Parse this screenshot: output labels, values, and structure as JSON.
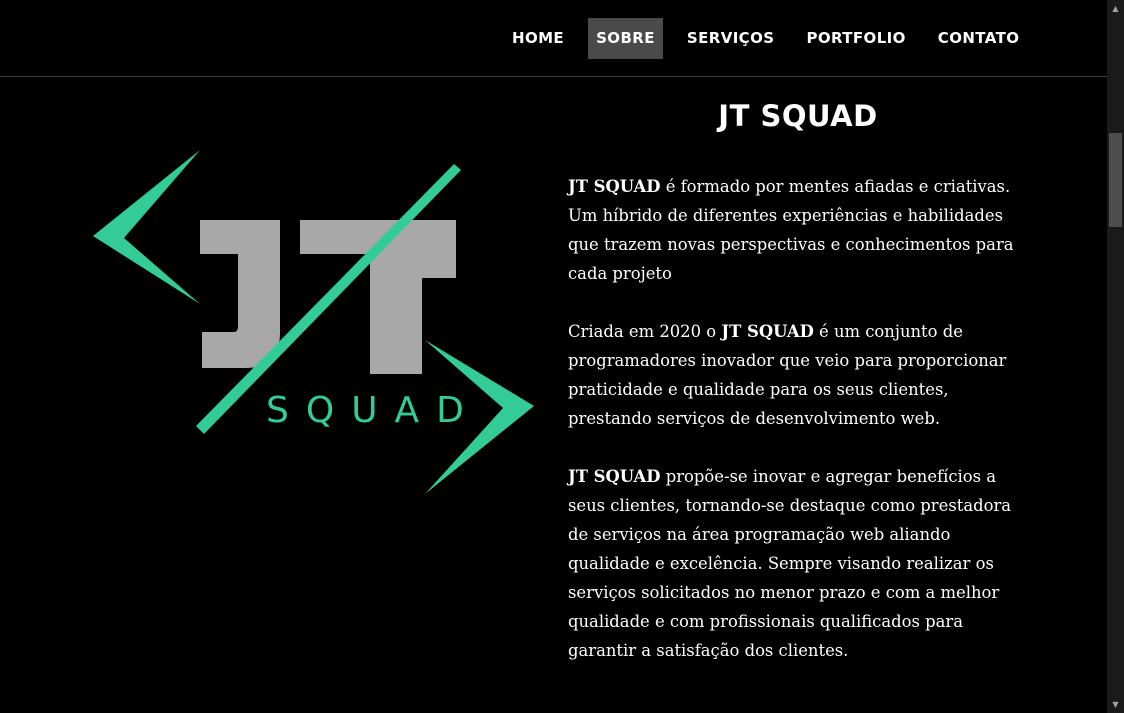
{
  "nav": {
    "items": [
      {
        "label": "HOME",
        "active": false
      },
      {
        "label": "SOBRE",
        "active": true
      },
      {
        "label": "SERVIÇOS",
        "active": false
      },
      {
        "label": "PORTFOLIO",
        "active": false
      },
      {
        "label": "CONTATO",
        "active": false
      }
    ]
  },
  "logo": {
    "letters": "JT",
    "word": "SQUAD",
    "colors": {
      "accent": "#33cc99",
      "letters": "#a8a8a8"
    }
  },
  "about": {
    "title": "JT SQUAD",
    "p1": {
      "strong": "JT SQUAD",
      "text": " é formado por mentes afiadas e criativas. Um híbrido de diferentes experiências e habilidades que trazem novas perspectivas e conhecimentos para cada projeto"
    },
    "p2": {
      "before": "Criada em 2020 o ",
      "strong": "JT SQUAD",
      "after": " é um conjunto de programadores inovador que veio para proporcionar praticidade e qualidade para os seus clientes, prestando serviços de desenvolvimento web."
    },
    "p3": {
      "strong": "JT SQUAD",
      "text": " propõe-se inovar e agregar benefícios a seus clientes, tornando-se destaque como prestadora de serviços na área programação web aliando qualidade e excelência. Sempre visando realizar os serviços solicitados no menor prazo e com a melhor qualidade e com profissionais qualificados para garantir a satisfação dos clientes."
    }
  },
  "colors": {
    "background": "#000000",
    "nav_active_bg": "#4a4a4a",
    "text": "#ffffff"
  }
}
